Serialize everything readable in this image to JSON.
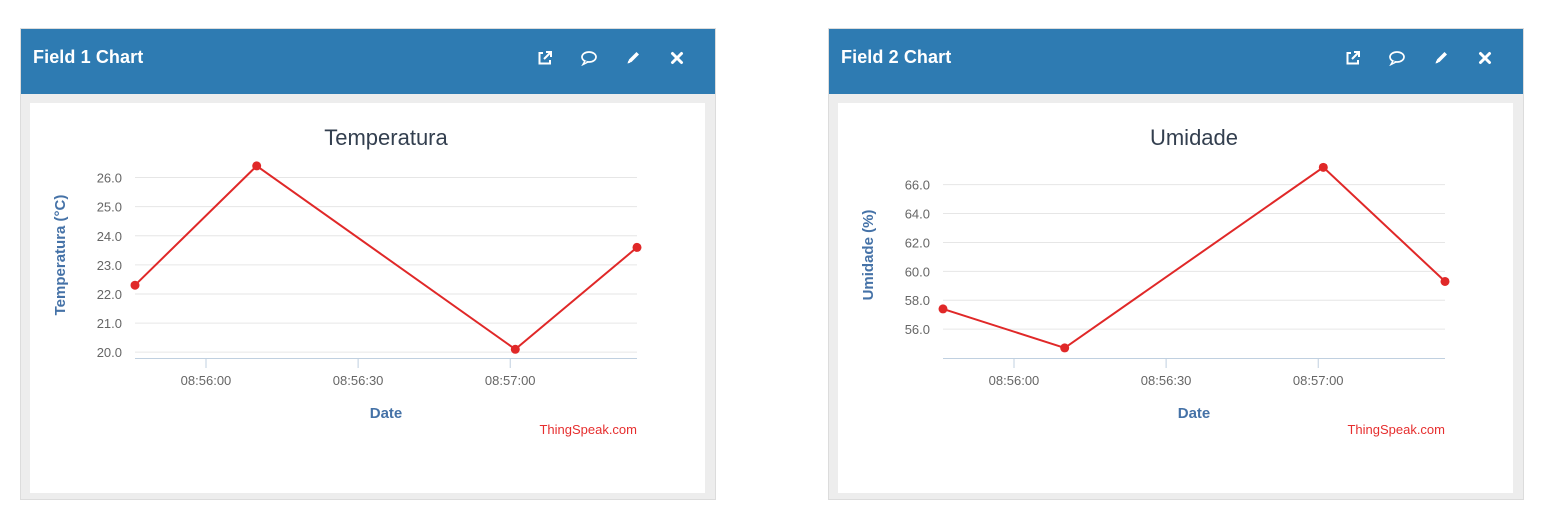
{
  "panels": [
    {
      "title": "Field 1 Chart",
      "tools": [
        "external-link-icon",
        "comment-icon",
        "pencil-icon",
        "close-icon"
      ]
    },
    {
      "title": "Field 2 Chart",
      "tools": [
        "external-link-icon",
        "comment-icon",
        "pencil-icon",
        "close-icon"
      ]
    }
  ],
  "colors": {
    "header": "#2e7bb2",
    "series": "#e02828",
    "axis_title": "#4572a7"
  },
  "chart_data": [
    {
      "type": "line",
      "title": "Temperatura",
      "xlabel": "Date",
      "ylabel": "Temperatura (°C)",
      "x_tick_labels": [
        "08:56:00",
        "08:56:30",
        "08:57:00"
      ],
      "y_tick_labels": [
        "20.0",
        "21.0",
        "22.0",
        "23.0",
        "24.0",
        "25.0",
        "26.0"
      ],
      "x_ticks": [
        "08:56:00",
        "08:56:30",
        "08:57:00"
      ],
      "xlim": [
        "08:55:46",
        "08:57:25"
      ],
      "ylim": [
        19.8,
        26.5
      ],
      "grid": true,
      "series": [
        {
          "x": [
            "08:55:46",
            "08:56:10",
            "08:57:01",
            "08:57:25"
          ],
          "y": [
            22.3,
            26.4,
            20.1,
            23.6
          ]
        }
      ],
      "credit": "ThingSpeak.com"
    },
    {
      "type": "line",
      "title": "Umidade",
      "xlabel": "Date",
      "ylabel": "Umidade (%)",
      "x_tick_labels": [
        "08:56:00",
        "08:56:30",
        "08:57:00"
      ],
      "y_tick_labels": [
        "56.0",
        "58.0",
        "60.0",
        "62.0",
        "64.0",
        "66.0"
      ],
      "x_ticks": [
        "08:56:00",
        "08:56:30",
        "08:57:00"
      ],
      "xlim": [
        "08:55:46",
        "08:57:25"
      ],
      "ylim": [
        54,
        67.5
      ],
      "grid": true,
      "series": [
        {
          "x": [
            "08:55:46",
            "08:56:10",
            "08:57:01",
            "08:57:25"
          ],
          "y": [
            57.4,
            54.7,
            67.2,
            59.3
          ]
        }
      ],
      "credit": "ThingSpeak.com"
    }
  ]
}
